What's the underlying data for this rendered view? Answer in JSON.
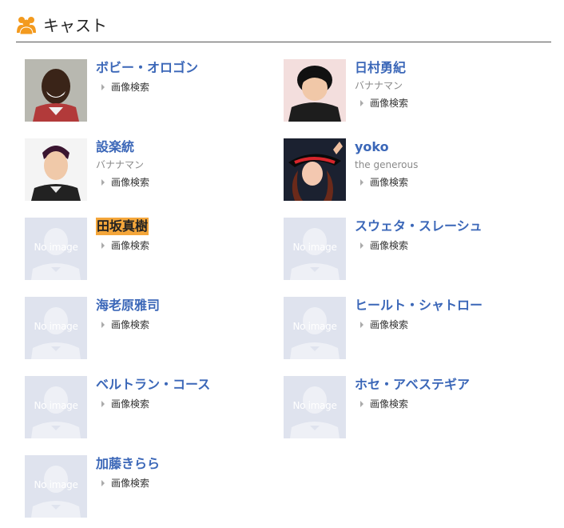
{
  "section": {
    "title": "キャスト",
    "icon": "people-icon"
  },
  "cast": [
    {
      "name": "ボビー・オロゴン",
      "group": "",
      "search_label": "画像検索",
      "photo": "photo",
      "no_image_label": ""
    },
    {
      "name": "日村勇紀",
      "group": "バナナマン",
      "search_label": "画像検索",
      "photo": "photo",
      "no_image_label": ""
    },
    {
      "name": "設楽統",
      "group": "バナナマン",
      "search_label": "画像検索",
      "photo": "photo",
      "no_image_label": ""
    },
    {
      "name": "yoko",
      "group": "the generous",
      "search_label": "画像検索",
      "photo": "photo",
      "no_image_label": ""
    },
    {
      "name": "田坂真樹",
      "group": "",
      "search_label": "画像検索",
      "photo": "none",
      "no_image_label": "No image",
      "highlight": true
    },
    {
      "name": "スウェタ・スレーシュ",
      "group": "",
      "search_label": "画像検索",
      "photo": "none",
      "no_image_label": "No image"
    },
    {
      "name": "海老原雅司",
      "group": "",
      "search_label": "画像検索",
      "photo": "none",
      "no_image_label": "No image"
    },
    {
      "name": "ヒールト・シャトロー",
      "group": "",
      "search_label": "画像検索",
      "photo": "none",
      "no_image_label": "No image"
    },
    {
      "name": "ベルトラン・コース",
      "group": "",
      "search_label": "画像検索",
      "photo": "none",
      "no_image_label": "No image"
    },
    {
      "name": "ホセ・アベステギア",
      "group": "",
      "search_label": "画像検索",
      "photo": "none",
      "no_image_label": "No image"
    },
    {
      "name": "加藤きらら",
      "group": "",
      "search_label": "画像検索",
      "photo": "none",
      "no_image_label": "No image"
    }
  ],
  "colors": {
    "link": "#3b67b8",
    "highlight": "#f4a63a",
    "icon": "#f39a1e",
    "placeholder_bg": "#dfe3ee"
  }
}
